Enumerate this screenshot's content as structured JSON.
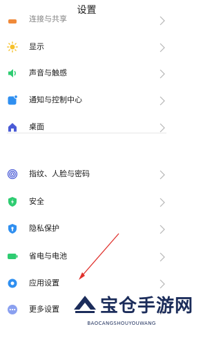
{
  "header": {
    "title": "设置"
  },
  "items": [
    {
      "label": "连接与共享",
      "icon": "share-icon"
    },
    {
      "label": "显示",
      "icon": "sun-icon"
    },
    {
      "label": "声音与触感",
      "icon": "speaker-icon"
    },
    {
      "label": "通知与控制中心",
      "icon": "notification-icon"
    },
    {
      "label": "桌面",
      "icon": "home-icon"
    },
    {
      "label": "指纹、人脸与密码",
      "icon": "fingerprint-icon"
    },
    {
      "label": "安全",
      "icon": "shield-icon"
    },
    {
      "label": "隐私保护",
      "icon": "privacy-icon"
    },
    {
      "label": "省电与电池",
      "icon": "battery-icon"
    },
    {
      "label": "应用设置",
      "icon": "gear-icon"
    },
    {
      "label": "更多设置",
      "icon": "more-icon"
    }
  ],
  "watermark": {
    "title": "宝仓手游网",
    "subtitle": "BAOCANGSHOUYOUWANG"
  },
  "colors": {
    "orange": "#f08a3a",
    "yellow": "#f6c12b",
    "green": "#2ecc71",
    "blue": "#2f8ff0",
    "indigo": "#4a5bd6",
    "red_arrow": "#e0312c",
    "watermark": "#1b2c5a"
  }
}
